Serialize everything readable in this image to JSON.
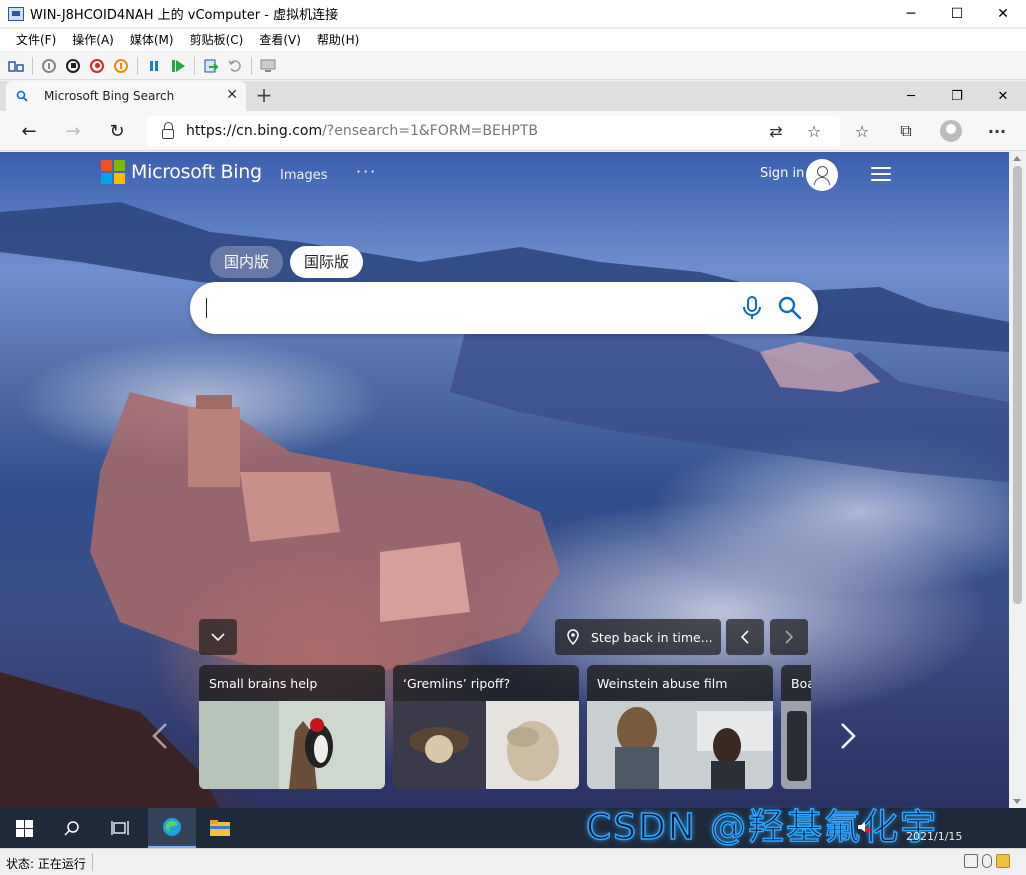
{
  "vm_window": {
    "title": "WIN-J8HCOID4NAH 上的 vComputer - 虚拟机连接",
    "menu": [
      "文件(F)",
      "操作(A)",
      "媒体(M)",
      "剪贴板(C)",
      "查看(V)",
      "帮助(H)"
    ],
    "controls": {
      "minimize": "─",
      "maximize": "☐",
      "close": "✕"
    }
  },
  "browser": {
    "tab": {
      "label": "Microsoft Bing Search",
      "close": "✕",
      "new_tab": "+"
    },
    "window_controls": {
      "minimize": "─",
      "restore": "❐",
      "close": "✕"
    },
    "url": {
      "host": "https://cn.bing.com",
      "path": "/?ensearch=1&FORM=BEHPTB"
    },
    "icons": {
      "back": "←",
      "forward": "→",
      "refresh": "↻",
      "translate": "⇄",
      "favorite": "☆",
      "favorites": "☆",
      "collections": "⧉",
      "more": "···"
    }
  },
  "bing": {
    "logo_text": "Microsoft Bing",
    "logo_colors": [
      "#f25022",
      "#7fba00",
      "#00a4ef",
      "#ffb900"
    ],
    "nav_images": "Images",
    "nav_more": "···",
    "sign_in": "Sign in",
    "region_tabs": {
      "cn": "国内版",
      "intl": "国际版"
    },
    "search_placeholder": "",
    "location_text": "Step back in time...",
    "cards": [
      {
        "title": "Small brains help"
      },
      {
        "title": "‘Gremlins’ ripoff?"
      },
      {
        "title": "Weinstein abuse film"
      },
      {
        "title": "Boa"
      }
    ]
  },
  "taskbar": {
    "watermark": "CSDN @羟基氟化宇",
    "date": "2021/1/15"
  },
  "statusbar": {
    "status": "状态: 正在运行"
  }
}
